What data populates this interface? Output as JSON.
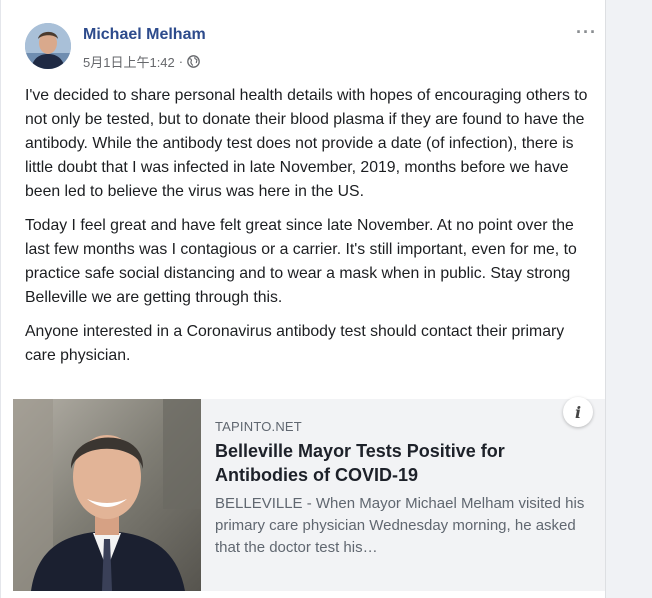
{
  "post": {
    "author": "Michael Melham",
    "timestamp": "5月1日上午1:42",
    "meta_separator": "·",
    "audience_icon": "globe-icon",
    "more_label": "···",
    "paragraphs": [
      "I've decided to share personal health details with hopes of encouraging others to not only be tested, but to donate their blood plasma if they are found to have the antibody. While the antibody test does not provide a date (of infection), there is little doubt that I was infected in late November, 2019, months before we have been led to believe the virus was here in the US.",
      "Today I feel great and have felt great since late November. At no point over the last few months was I contagious or a carrier. It's still important, even for me, to practice safe social distancing and to wear a mask when in public. Stay strong Belleville we are getting through this.",
      "Anyone interested in a Coronavirus antibody test should contact their primary care physician."
    ]
  },
  "link_card": {
    "domain": "TAPINTO.NET",
    "headline": "Belleville Mayor Tests Positive for Antibodies of COVID-19",
    "snippet": "BELLEVILLE - When Mayor Michael Melham visited his primary care physician Wednesday morning, he asked that the doctor test his…",
    "info_icon_label": "i"
  },
  "colors": {
    "author_link": "#2d4b8c",
    "card_background": "#f2f3f5",
    "page_gutter": "#f0f2f5"
  }
}
